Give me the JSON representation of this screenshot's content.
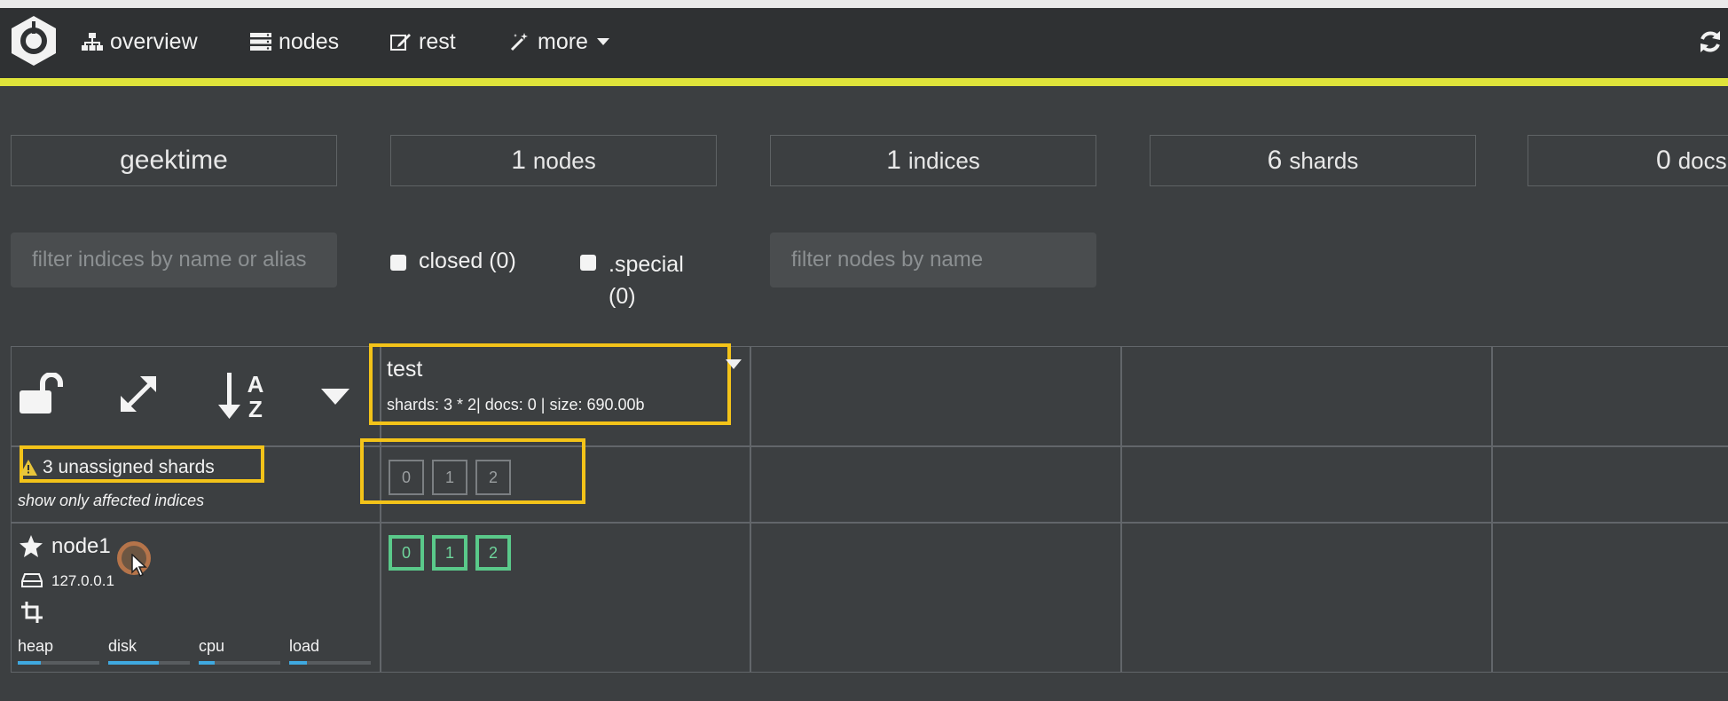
{
  "nav": {
    "overview": "overview",
    "nodes": "nodes",
    "rest": "rest",
    "more": "more"
  },
  "stats": {
    "cluster_name": "geektime",
    "nodes_count": "1",
    "nodes_label": "nodes",
    "indices_count": "1",
    "indices_label": "indices",
    "shards_count": "6",
    "shards_label": "shards",
    "docs_count": "0",
    "docs_label": "docs"
  },
  "filters": {
    "indices_placeholder": "filter indices by name or alias",
    "closed_label": "closed (0)",
    "special_label_line1": ".special",
    "special_label_line2": "(0)",
    "nodes_placeholder": "filter nodes by name"
  },
  "index": {
    "name": "test",
    "meta": "shards: 3 * 2| docs: 0 | size: 690.00b"
  },
  "unassigned": {
    "label": "3 unassigned shards",
    "affected_link": "show only affected indices",
    "shards": [
      "0",
      "1",
      "2"
    ]
  },
  "node": {
    "name": "node1",
    "ip": "127.0.0.1",
    "shards": [
      "0",
      "1",
      "2"
    ],
    "metrics": [
      {
        "label": "heap",
        "fraction": 0.28
      },
      {
        "label": "disk",
        "fraction": 0.62
      },
      {
        "label": "cpu",
        "fraction": 0.2
      },
      {
        "label": "load",
        "fraction": 0.22
      }
    ]
  },
  "colors": {
    "accent_line": "#dfe33a",
    "highlight": "#f3c319",
    "shard_assigned": "#5ac98a",
    "metric_fill": "#3fa9e0"
  }
}
